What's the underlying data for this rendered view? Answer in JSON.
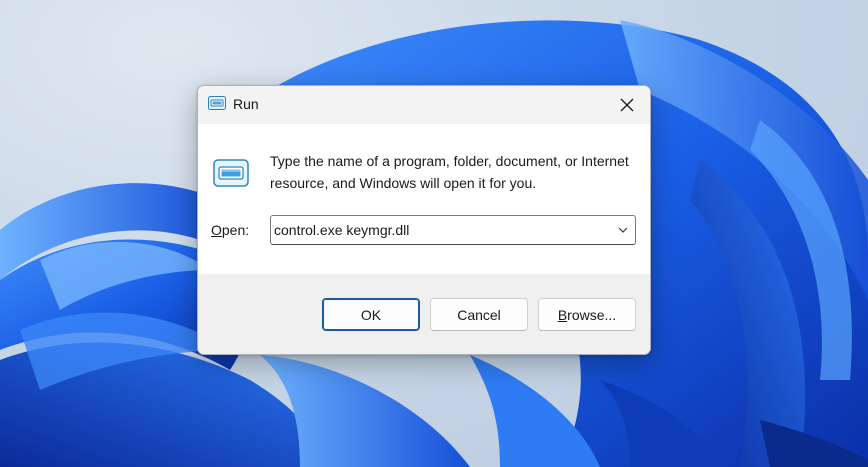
{
  "window": {
    "title": "Run"
  },
  "dialog": {
    "description": "Type the name of a program, folder, document, or Internet resource, and Windows will open it for you.",
    "open_label_accel": "O",
    "open_label_rest": "pen:",
    "command_value": "control.exe keymgr.dll"
  },
  "buttons": {
    "ok": "OK",
    "cancel": "Cancel",
    "browse_accel": "B",
    "browse_rest": "rowse..."
  },
  "colors": {
    "accent": "#1a5a9e",
    "wallpaper_blue": "#1f5fe0",
    "footer_bg": "#f0f0f0"
  },
  "icons": {
    "title": "run-icon",
    "dialog": "run-icon",
    "close": "close-icon",
    "dropdown": "chevron-down-icon"
  }
}
